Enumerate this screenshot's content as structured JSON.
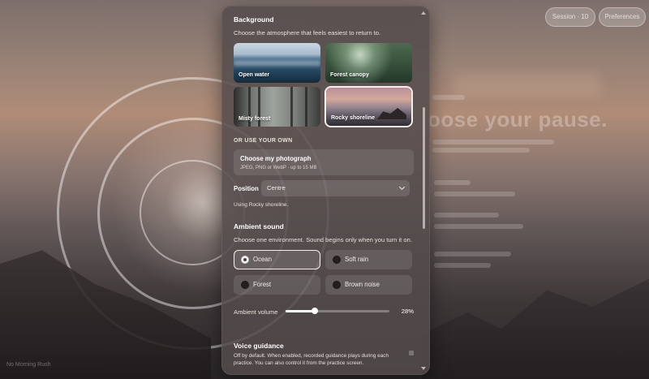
{
  "background_app": {
    "top_buttons": [
      "Session · 10",
      "Preferences"
    ],
    "heading": "oose your pause.",
    "footer": "No Morning Rush"
  },
  "panel": {
    "background": {
      "title": "Background",
      "subtitle": "Choose the atmosphere that feels easiest to return to.",
      "options": [
        {
          "label": "Open water",
          "selected": false
        },
        {
          "label": "Forest canopy",
          "selected": false
        },
        {
          "label": "Misty forest",
          "selected": false
        },
        {
          "label": "Rocky shoreline",
          "selected": true
        }
      ]
    },
    "own": {
      "caps": "OR USE YOUR OWN",
      "button_title": "Choose my photograph",
      "button_hint": "JPEG, PNG or WebP · up to 15 MB"
    },
    "position": {
      "label": "Position",
      "value": "Centre",
      "note": "Using Rocky shoreline."
    },
    "ambient": {
      "title": "Ambient sound",
      "subtitle": "Choose one environment. Sound begins only when you turn it on.",
      "options": [
        {
          "label": "Ocean",
          "selected": true
        },
        {
          "label": "Soft rain",
          "selected": false
        },
        {
          "label": "Forest",
          "selected": false
        },
        {
          "label": "Brown noise",
          "selected": false
        }
      ],
      "volume_label": "Ambient volume",
      "volume_value": "28%",
      "volume_fraction": 0.28
    },
    "voice": {
      "title": "Voice guidance",
      "description": "Off by default. When enabled, recorded guidance plays during each practice. You can also control it from the practice screen.",
      "enabled": false
    }
  }
}
